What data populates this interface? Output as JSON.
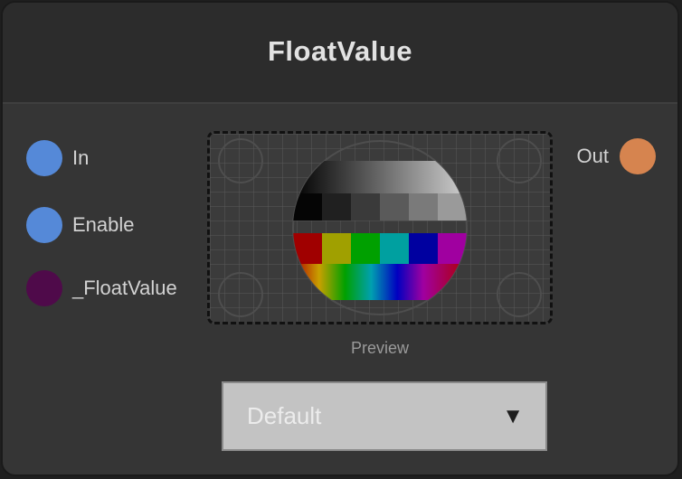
{
  "node": {
    "title": "FloatValue",
    "inputs": [
      {
        "label": "In",
        "color": "#5589d8"
      },
      {
        "label": "Enable",
        "color": "#5589d8"
      },
      {
        "label": "_FloatValue",
        "color": "#4f0a4a"
      }
    ],
    "outputs": [
      {
        "label": "Out",
        "color": "#d6844f"
      }
    ],
    "preview": {
      "caption": "Preview",
      "icon": "test-pattern-image"
    },
    "mode_select": {
      "value": "Default",
      "icon": "triangle-down-icon"
    }
  }
}
